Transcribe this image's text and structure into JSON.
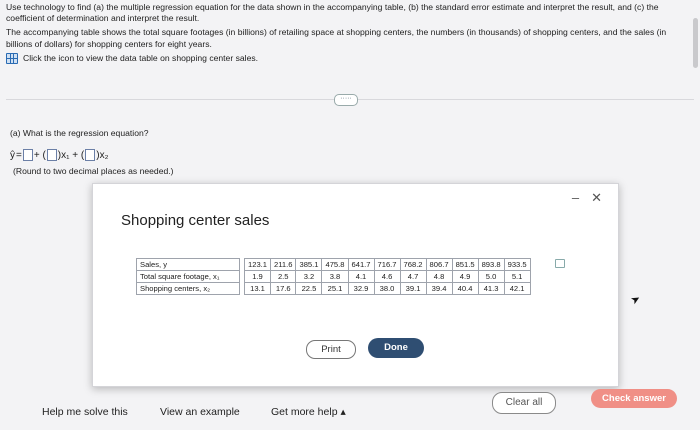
{
  "problem": {
    "line1": "Use technology to find (a) the multiple regression equation for the data shown in the accompanying table, (b) the standard error estimate and interpret the result, and (c) the coefficient of determination and interpret the result.",
    "line2": "The accompanying table shows the total square footages (in billions) of retailing space at shopping centers, the numbers (in thousands) of shopping centers, and the sales (in billions of dollars) for shopping centers for eight years.",
    "data_link": "Click the icon to view the data table on shopping center sales."
  },
  "more_button": "·····",
  "question": {
    "label": "(a) What is the regression equation?",
    "yhat": "ŷ",
    "eq": "=",
    "plus1": "+ (",
    "x1": ")x₁ + (",
    "x2": ")x₂",
    "hint": "(Round to two decimal places as needed.)"
  },
  "modal": {
    "title": "Shopping center sales",
    "minimize": "–",
    "close": "✕",
    "rows": [
      {
        "label": "Sales, y",
        "values": [
          "123.1",
          "211.6",
          "385.1",
          "475.8",
          "641.7",
          "716.7",
          "768.2",
          "806.7",
          "851.5",
          "893.8",
          "933.5"
        ]
      },
      {
        "label": "Total square footage, x₁",
        "values": [
          "1.9",
          "2.5",
          "3.2",
          "3.8",
          "4.1",
          "4.6",
          "4.7",
          "4.8",
          "4.9",
          "5.0",
          "5.1"
        ]
      },
      {
        "label": "Shopping centers, x₂",
        "values": [
          "13.1",
          "17.6",
          "22.5",
          "25.1",
          "32.9",
          "38.0",
          "39.1",
          "39.4",
          "40.4",
          "41.3",
          "42.1"
        ]
      }
    ],
    "print": "Print",
    "done": "Done"
  },
  "footer": {
    "help": "Help me solve this",
    "example": "View an example",
    "more": "Get more help ▴",
    "clear": "Clear all",
    "check": "Check answer"
  },
  "colors": {
    "done_button": "#2f4e72",
    "check_button": "#f08f86",
    "icon": "#2a6bb3"
  }
}
